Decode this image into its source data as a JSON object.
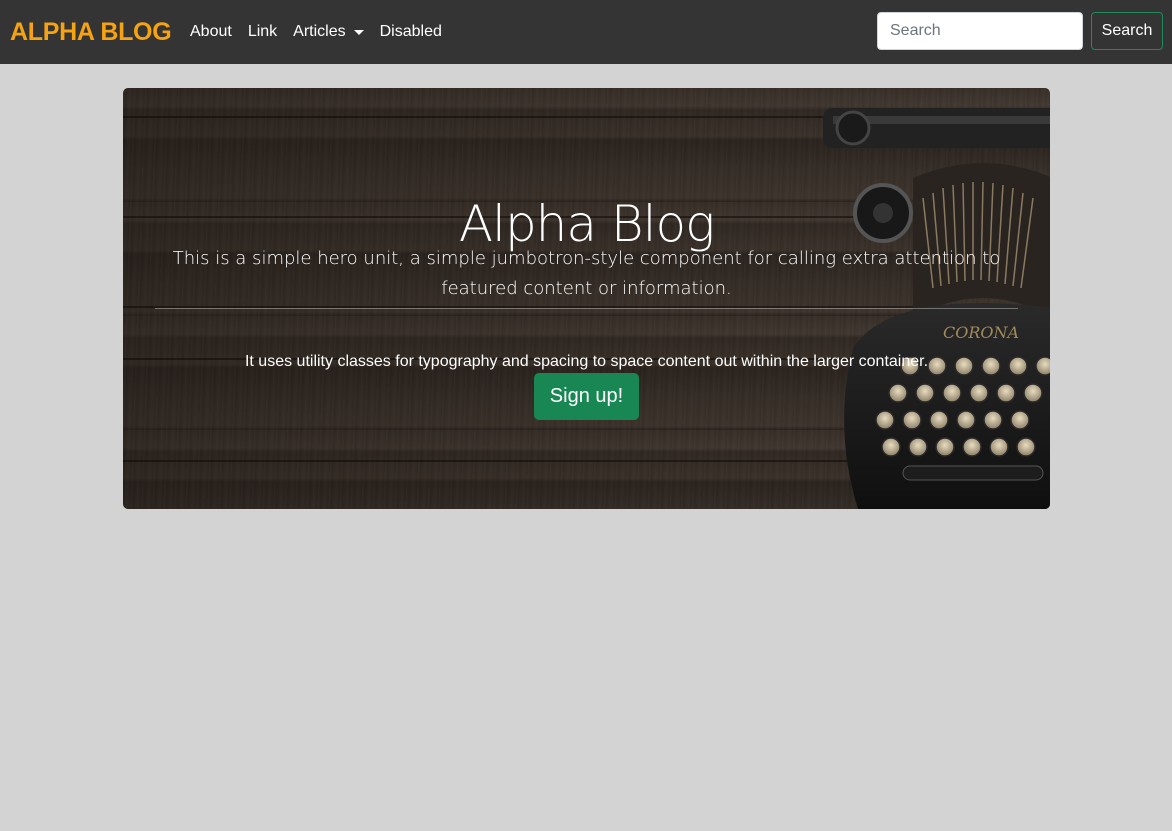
{
  "navbar": {
    "brand": "ALPHA BLOG",
    "links": [
      {
        "label": "About"
      },
      {
        "label": "Link"
      },
      {
        "label": "Articles"
      },
      {
        "label": "Disabled"
      }
    ],
    "search": {
      "placeholder": "Search",
      "value": "",
      "button_label": "Search"
    }
  },
  "hero": {
    "title": "Alpha Blog",
    "lead": "This is a simple hero unit, a simple jumbotron-style component for calling extra attention to featured content or information.",
    "text": "It uses utility classes for typography and spacing to space content out within the larger container.",
    "button_label": "Sign up!"
  },
  "colors": {
    "brand": "#f5a213",
    "navbar_bg": "#343434",
    "page_bg": "#d3d3d3",
    "success": "#198754"
  },
  "icons": {
    "articles_dropdown": "caret-down-icon"
  }
}
